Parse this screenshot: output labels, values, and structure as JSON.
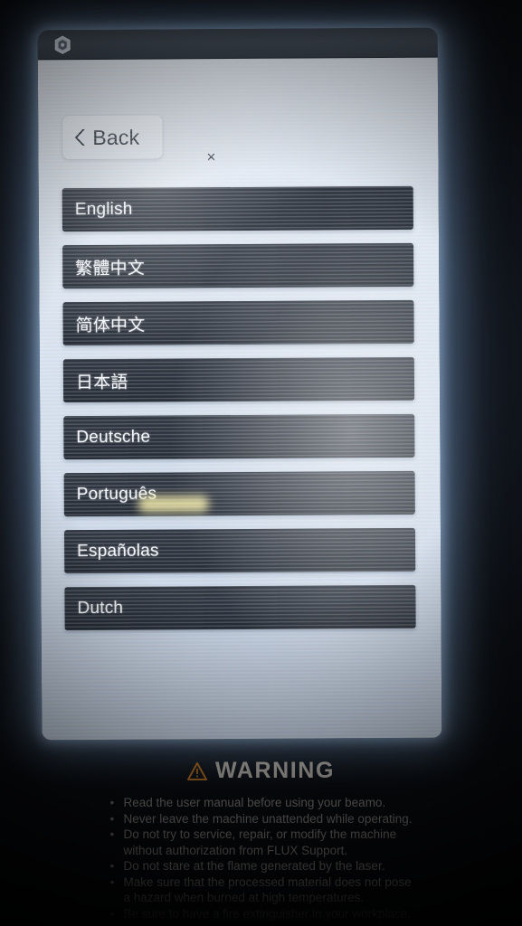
{
  "device": {
    "logo_icon": "flux-hexagon-logo-icon"
  },
  "header": {
    "back_label": "Back",
    "back_icon": "chevron-left-icon",
    "close_label": "×"
  },
  "language_list": {
    "items": [
      {
        "label": "English",
        "script": "latin"
      },
      {
        "label": "繁體中文",
        "script": "cjk"
      },
      {
        "label": "简体中文",
        "script": "cjk"
      },
      {
        "label": "日本語",
        "script": "cjk"
      },
      {
        "label": "Deutsche",
        "script": "latin"
      },
      {
        "label": "Português",
        "script": "latin"
      },
      {
        "label": "Españolas",
        "script": "latin"
      },
      {
        "label": "Dutch",
        "script": "latin"
      }
    ]
  },
  "warning": {
    "icon": "warning-triangle-icon",
    "title": "WARNING",
    "bullets": [
      {
        "text": "Read the user manual before using your beamo."
      },
      {
        "text": "Never leave the machine unattended while operating."
      },
      {
        "text": "Do not try to service, repair, or modify the machine",
        "cont": "without authorization from FLUX Support."
      },
      {
        "text": "Do not stare at the flame generated by the laser."
      },
      {
        "text": "Make sure that the processed material does not pose",
        "cont": "a hazard when burned at high temperatures."
      },
      {
        "text": "Be sure to have a fire extinguisher in your workplace."
      }
    ]
  },
  "colors": {
    "row_background": "#2b323d",
    "row_text": "#f2f5f9",
    "screen_background": "#dbe4ef",
    "titlebar": "#434c57",
    "warning_accent": "#d7862a",
    "warning_title": "#ddd8d0"
  }
}
